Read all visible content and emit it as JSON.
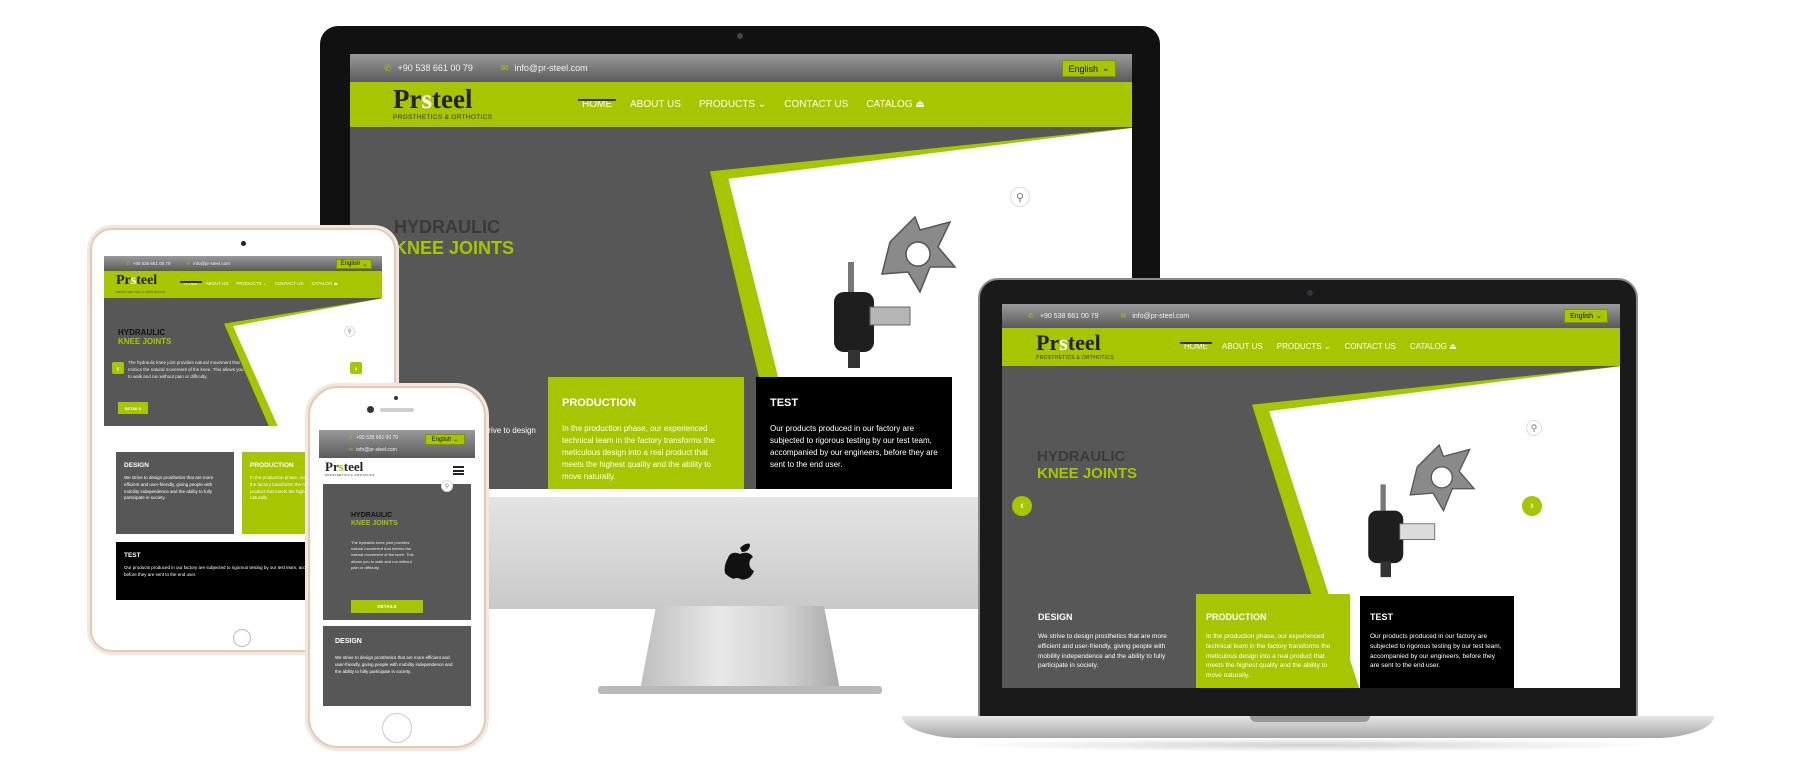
{
  "site": {
    "phone": "+90 538 661 00 79",
    "email": "info@pr-steel.com",
    "language": "English",
    "logo_main_a": "Pr",
    "logo_main_s": "s",
    "logo_main_b": "teel",
    "logo_sub": "PROSTHETICS & ORTHOTICS",
    "menu": [
      "HOME",
      "ABOUT US",
      "PRODUCTS",
      "CONTACT US",
      "CATALOG"
    ],
    "hero": {
      "line1": "HYDRAULIC",
      "line2": "KNEE JOINTS",
      "text": "The hydraulic knee joint provides natural movement that mimics the natural movement of the knee. This allows you to walk and run without pain or difficulty.",
      "button": "DETAILS"
    },
    "cards": {
      "design_title": "DESIGN",
      "design_text": "We strive to design prosthetics that are more efficient and user-friendly, giving people with mobility independence and the ability to fully participate in society.",
      "production_title": "PRODUCTION",
      "production_text": "In the production phase, our experienced technical team in the factory transforms the meticulous design into a real product that meets the highest quality and the ability to move naturally.",
      "test_title": "TEST",
      "test_text": "Our products produced in our factory are subjected to rigorous testing by our test team, accompanied by our engineers, before they are sent to the end user."
    }
  },
  "colors": {
    "accent": "#a8c600",
    "hero_bg": "#575757",
    "topbar": "#7a7a7a",
    "test_card": "#000000"
  },
  "icons": {
    "phone": "phone-icon",
    "mail": "mail-icon",
    "zoom": "magnifier-icon",
    "apple": "apple-logo-icon"
  }
}
